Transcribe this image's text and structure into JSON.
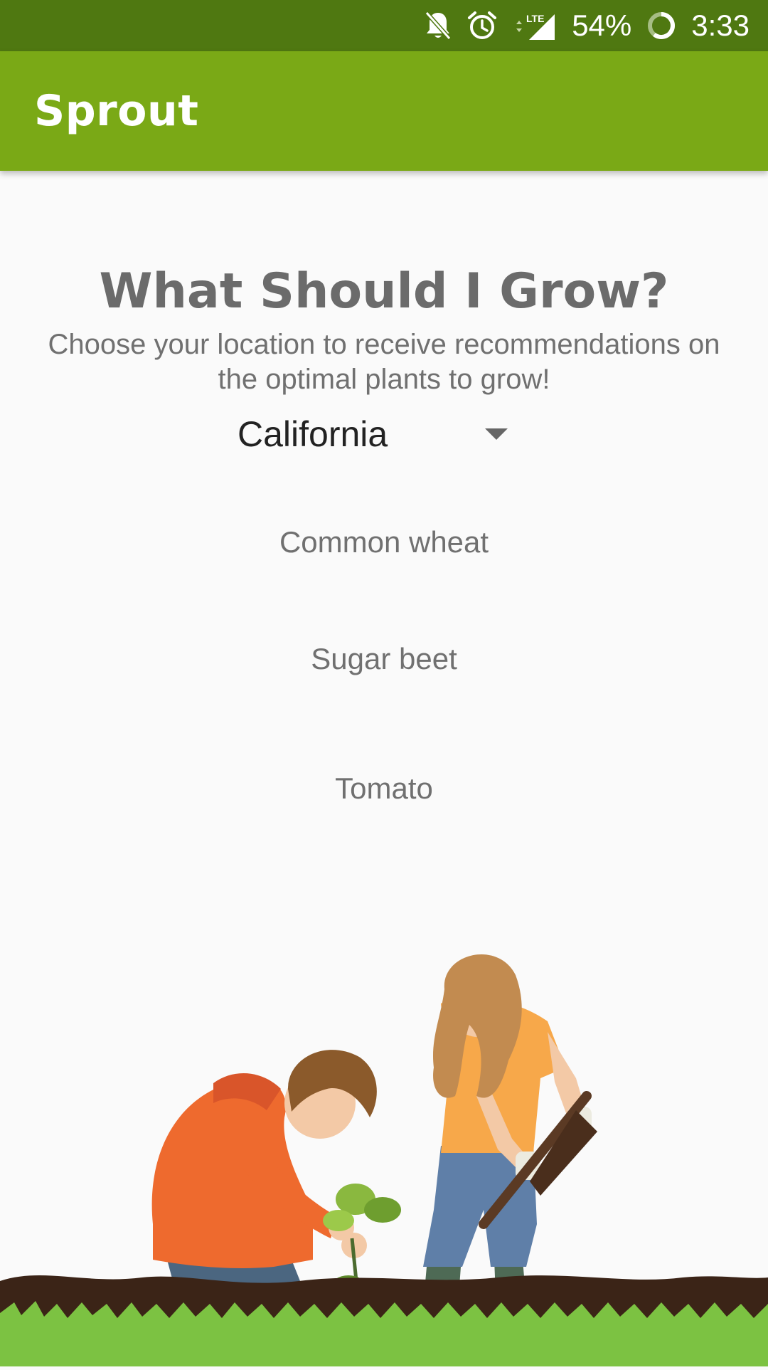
{
  "status_bar": {
    "battery": "54%",
    "time": "3:33",
    "network": "LTE",
    "icons": [
      "notifications-off-icon",
      "alarm-icon",
      "signal-icon",
      "battery-icon"
    ]
  },
  "app_bar": {
    "title": "Sprout"
  },
  "main": {
    "heading": "What Should I Grow?",
    "subtitle": "Choose your location to receive recommendations on the optimal plants to grow!",
    "location": {
      "selected": "California"
    },
    "recommendations": [
      "Common wheat",
      "Sugar beet",
      "Tomato"
    ]
  },
  "colors": {
    "status_bar": "#4f7811",
    "app_bar": "#7aa916",
    "background": "#fafafa",
    "grass": "#7cc242",
    "soil": "#3b2417"
  }
}
